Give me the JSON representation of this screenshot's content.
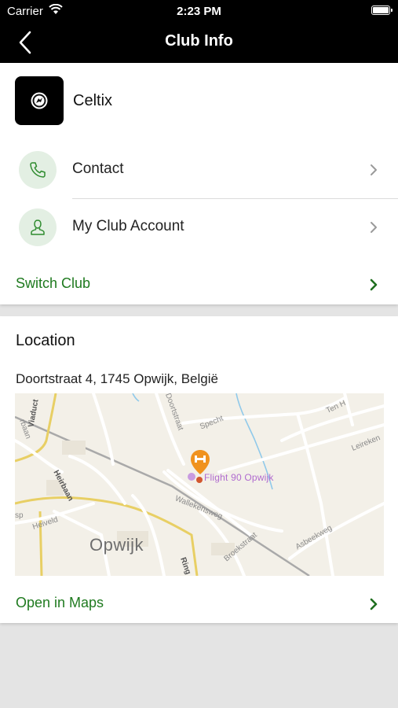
{
  "status_bar": {
    "carrier": "Carrier",
    "time": "2:23 PM"
  },
  "nav": {
    "title": "Club Info",
    "back_icon": "chevron-left-icon"
  },
  "club": {
    "name": "Celtix"
  },
  "menu": {
    "contact": {
      "label": "Contact",
      "icon": "phone-icon"
    },
    "account": {
      "label": "My Club Account",
      "icon": "user-icon"
    },
    "switch": {
      "label": "Switch Club"
    }
  },
  "location": {
    "title": "Location",
    "address": "Doortstraat 4, 1745 Opwijk, België",
    "map": {
      "poi": "Flight 90 Opwijk",
      "city": "Opwijk",
      "streets": [
        "Viaduct",
        "rbaan",
        "Heirbaan",
        "Heiveld",
        "sp",
        "Doortstraat",
        "Specht",
        "Wallekensweg",
        "Broekstraat",
        "Asbeekweg",
        "Leireken",
        "Ten H",
        "Ring"
      ]
    },
    "open_maps": "Open in Maps"
  },
  "colors": {
    "accent": "#1f7a1f",
    "nav_bg": "#000000",
    "icon_circle": "#e3efe3",
    "poi": "#f0921e"
  }
}
